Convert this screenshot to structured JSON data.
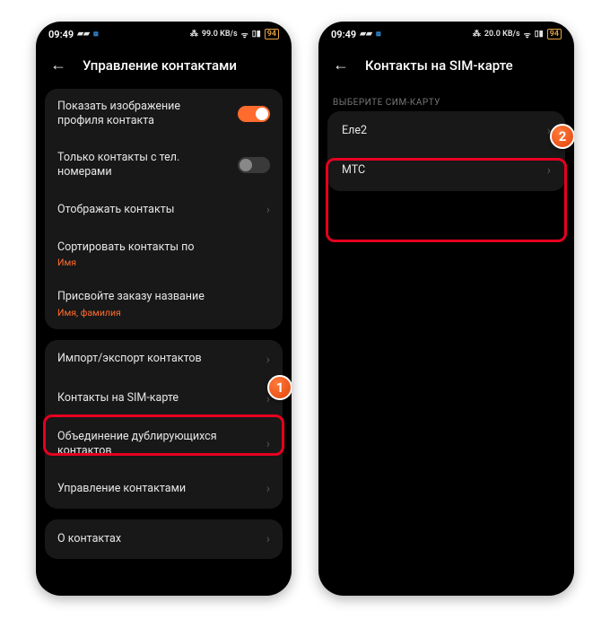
{
  "status": {
    "time": "09:49",
    "net_speed": "99.0 KB/s",
    "net_speed_2": "20.0 KB/s",
    "battery": "94"
  },
  "screen1": {
    "title": "Управление контактами",
    "group1": {
      "show_profile_image": "Показать изображение профиля контакта",
      "only_with_phone": "Только контакты с тел. номерами",
      "display_contacts": "Отображать контакты",
      "sort_by": "Сортировать контакты по",
      "sort_by_value": "Имя",
      "assign_name": "Присвойте заказу название",
      "assign_name_value": "Имя, фамилия"
    },
    "group2": {
      "import_export": "Импорт/экспорт контактов",
      "sim_contacts": "Контакты на SIM-карте",
      "merge_duplicates": "Объединение дублирующихся контактов",
      "manage_contacts": "Управление контактами"
    },
    "group3": {
      "about": "О контактах"
    }
  },
  "screen2": {
    "title": "Контакты на SIM-карте",
    "section_header": "ВЫБЕРИТЕ СИМ-КАРТУ",
    "sim1": "Еле2",
    "sim2": "МТС"
  },
  "badges": {
    "one": "1",
    "two": "2"
  }
}
